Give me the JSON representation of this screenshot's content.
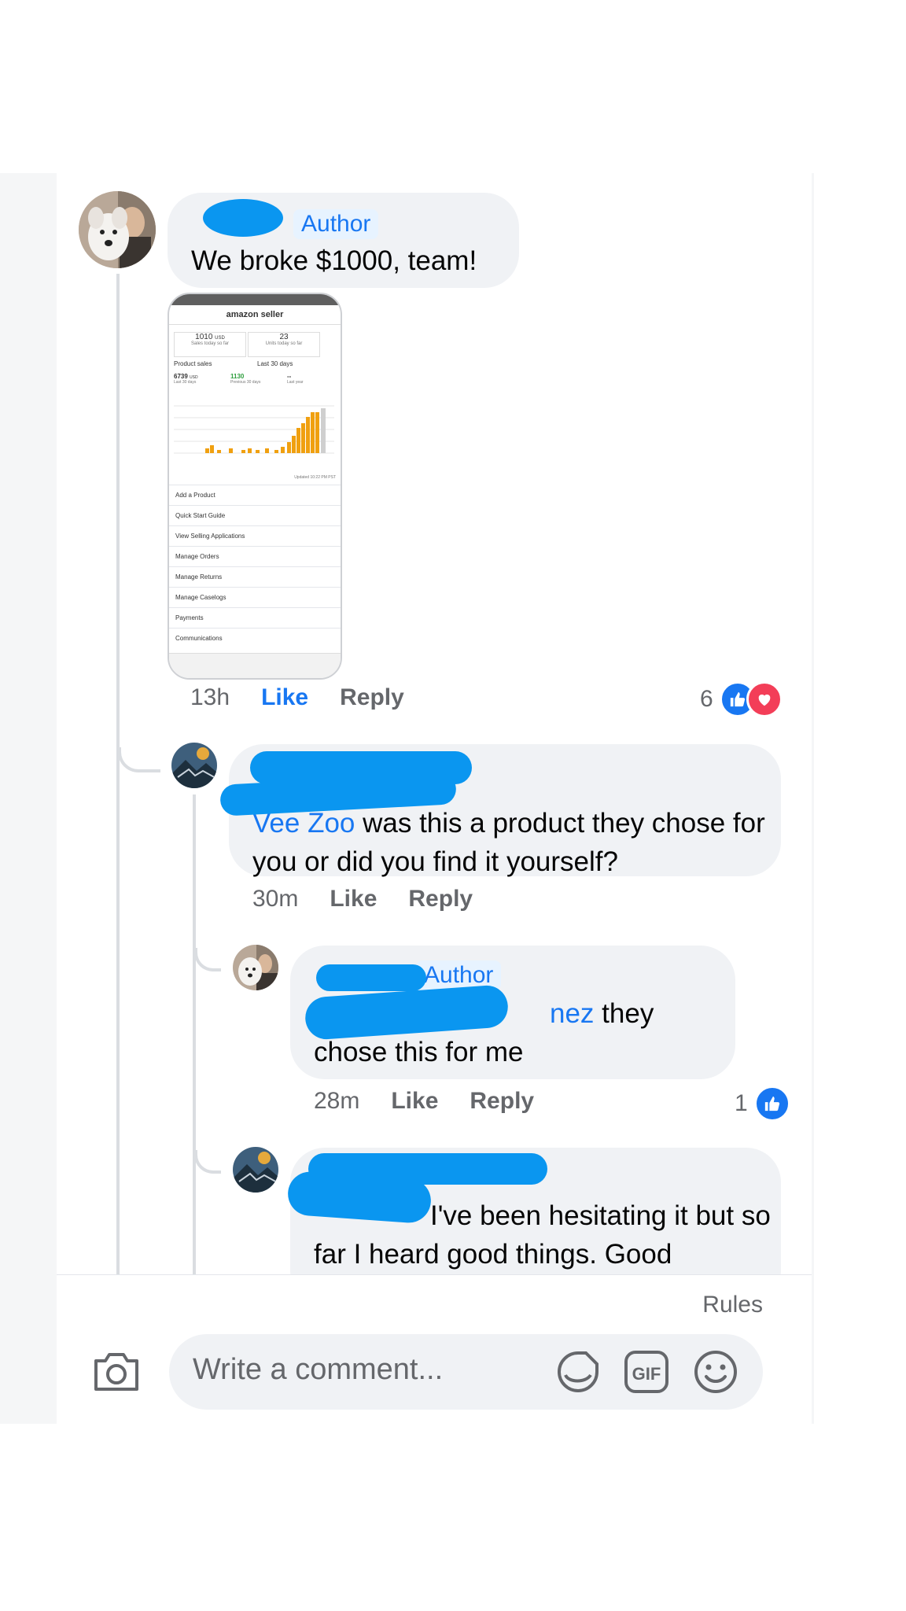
{
  "comments": {
    "main": {
      "badge": "Author",
      "text": "We broke $1000, team!",
      "time": "13h",
      "like": "Like",
      "reply": "Reply",
      "reaction_count": "6"
    },
    "reply1": {
      "mention": "Vee Zoo",
      "text": " was this a product they chose for you or did you find it yourself?",
      "time": "30m",
      "like": "Like",
      "reply": "Reply"
    },
    "reply2": {
      "badge": "Author",
      "mention": "nez",
      "text": " they chose this for me",
      "time": "28m",
      "like": "Like",
      "reply": "Reply",
      "reaction_count": "1"
    },
    "reply3": {
      "text": "I've been hesitating it but so far I heard good things. Good"
    }
  },
  "screenshot": {
    "app": "amazon seller",
    "stat1_value": "1010",
    "stat1_unit": "USD",
    "stat1_label": "Sales today so far",
    "stat2_value": "23",
    "stat2_label": "Units today so far",
    "filter_left": "Product sales",
    "filter_right": "Last 30 days",
    "total_value": "6739",
    "total_unit": "USD",
    "total_label": "Last 30 days",
    "prev_value": "1130",
    "prev_label": "Previous 30 days",
    "last_year_value": "--",
    "last_year_label": "Last year",
    "updated": "Updated 10:22 PM PST",
    "menu": [
      "Add a Product",
      "Quick Start Guide",
      "View Selling Applications",
      "Manage Orders",
      "Manage Returns",
      "Manage Caselogs",
      "Payments",
      "Communications"
    ]
  },
  "composer": {
    "rules": "Rules",
    "placeholder": "Write a comment..."
  },
  "colors": {
    "accent": "#1877f2",
    "redaction": "#0a96f0",
    "bubble": "#f0f2f5"
  }
}
